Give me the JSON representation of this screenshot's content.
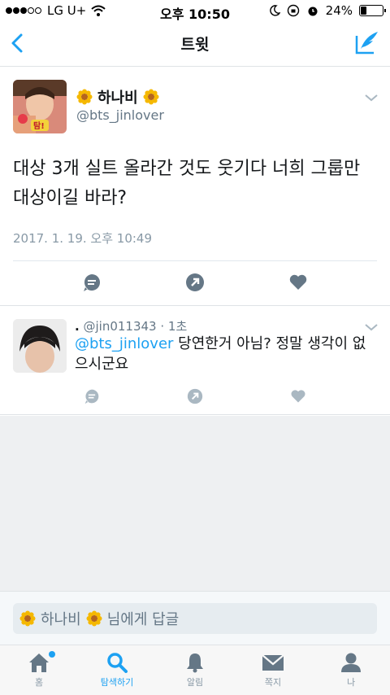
{
  "status": {
    "carrier": "LG U+",
    "time": "오후 10:50",
    "battery": "24%",
    "battery_level": 0.24
  },
  "nav": {
    "title": "트윗"
  },
  "tweet": {
    "name": "하나비",
    "handle": "@bts_jinlover",
    "text": "대상 3개 실트 올라간 것도 웃기다 너희 그룹만 대상이길 바라?",
    "timestamp": "2017. 1. 19. 오후 10:49",
    "avatar_badge": "탐!"
  },
  "reply": {
    "name": ".",
    "handle": "@jin011343",
    "age": "· 1초",
    "mention": "@bts_jinlover",
    "text": " 당연한거 아님? 정말 생각이 없으시군요"
  },
  "reply_bar": {
    "name": "하나비",
    "suffix": "님에게 답글"
  },
  "tabs": [
    {
      "label": "홈",
      "icon": "home-icon"
    },
    {
      "label": "탐색하기",
      "icon": "search-icon"
    },
    {
      "label": "알림",
      "icon": "bell-icon"
    },
    {
      "label": "쪽지",
      "icon": "mail-icon"
    },
    {
      "label": "나",
      "icon": "person-icon"
    }
  ],
  "colors": {
    "accent": "#1da1f2",
    "icon_grey": "#657786",
    "flower": "#f5b800"
  }
}
